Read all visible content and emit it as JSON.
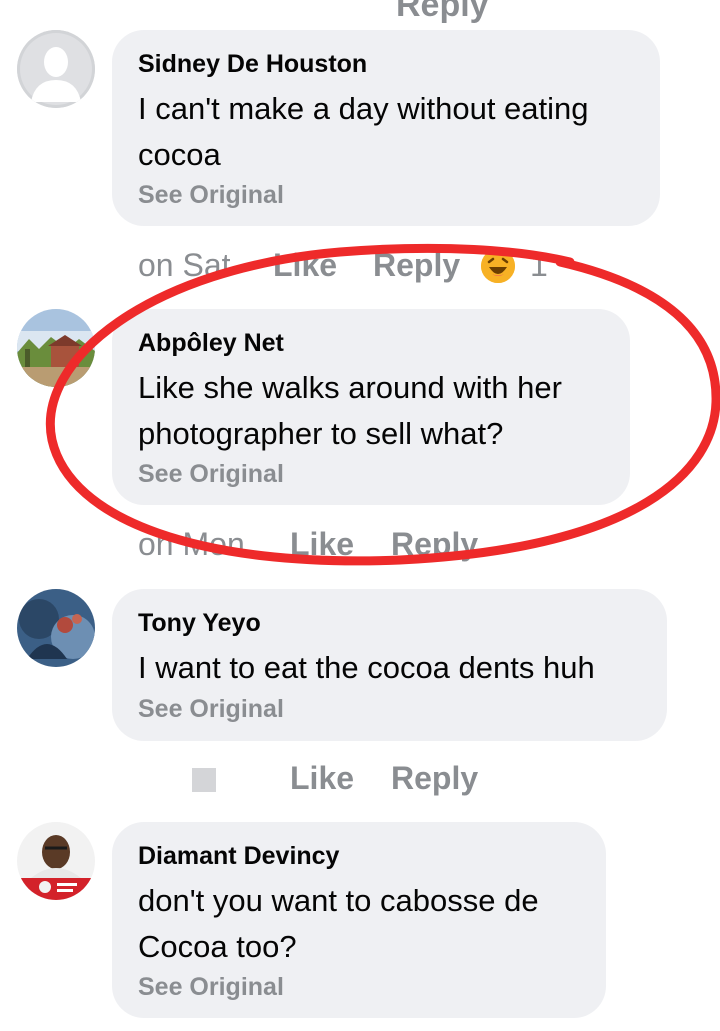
{
  "top_partial_reply": "Reply",
  "comments": [
    {
      "author": "Sidney De Houston",
      "text": "I can't make a day without eating cocoa",
      "see_original": "See Original",
      "time": "on Sat",
      "like": "Like",
      "reply": "Reply",
      "reaction_count": "1"
    },
    {
      "author": "Abpôley Net",
      "text": "Like she walks around with her photographer to sell what?",
      "see_original": "See Original",
      "time": "on Mon",
      "like": "Like",
      "reply": "Reply"
    },
    {
      "author": "Tony Yeyo",
      "text": "I want to eat the cocoa dents huh",
      "see_original": "See Original",
      "like": "Like",
      "reply": "Reply"
    },
    {
      "author": "Diamant Devincy",
      "text": "don't you want to cabosse de Cocoa too?",
      "see_original": "See Original"
    }
  ],
  "colors": {
    "bubble": "#eff0f3",
    "muted_text": "#8a8d91",
    "highlight": "#ee2a2a"
  },
  "icons": {
    "reaction": "laughing-face-icon",
    "default_avatar": "default-person-icon"
  }
}
